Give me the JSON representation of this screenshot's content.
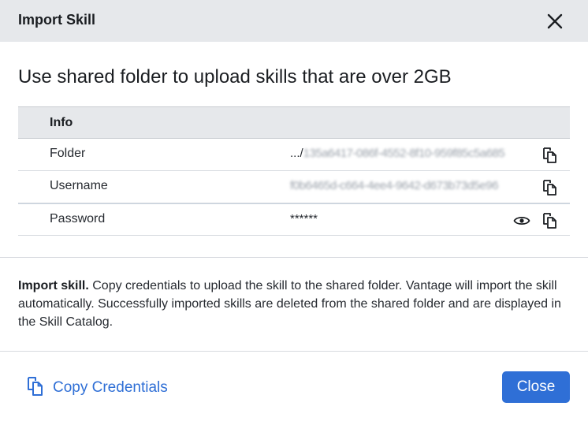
{
  "dialog": {
    "title": "Import Skill",
    "heading": "Use shared folder to upload skills that are over 2GB"
  },
  "table": {
    "header": "Info",
    "rows": [
      {
        "label": "Folder",
        "prefix": ".../",
        "value": "135a6417-086f-4552-8f10-959f85c5a685"
      },
      {
        "label": "Username",
        "prefix": "",
        "value": "f0b6465d-c664-4ee4-9642-d673b73d5e96"
      },
      {
        "label": "Password",
        "prefix": "",
        "value": "******"
      }
    ]
  },
  "description": {
    "bold": "Import skill.",
    "text": " Copy credentials to upload the skill to the shared folder. Vantage will import the skill automatically. Successfully imported skills are deleted from the shared folder and are displayed in the Skill Catalog."
  },
  "footer": {
    "copy_label": "Copy Credentials",
    "close_label": "Close"
  },
  "colors": {
    "accent": "#2f6fd6",
    "header_bg": "#e6e8eb"
  },
  "icons": [
    "close-icon",
    "copy-icon",
    "eye-icon"
  ]
}
